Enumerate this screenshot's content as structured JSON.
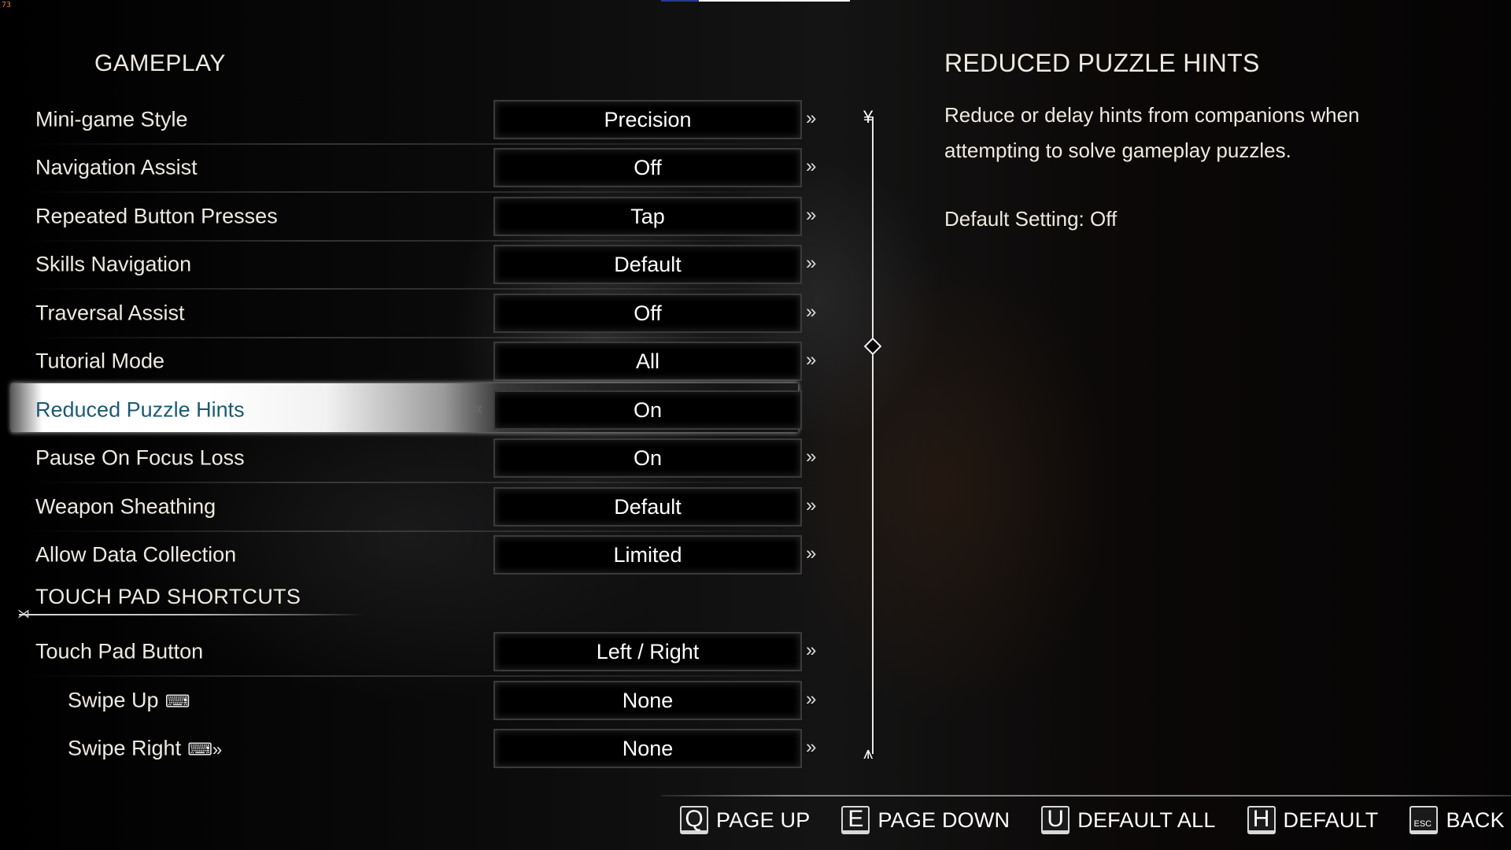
{
  "overlay": {
    "fps": "73",
    "top_progress": 0.2
  },
  "section": {
    "title": "GAMEPLAY"
  },
  "settings": [
    {
      "label": "Mini-game Style",
      "value": "Precision"
    },
    {
      "label": "Navigation Assist",
      "value": "Off"
    },
    {
      "label": "Repeated Button Presses",
      "value": "Tap"
    },
    {
      "label": "Skills Navigation",
      "value": "Default"
    },
    {
      "label": "Traversal Assist",
      "value": "Off"
    },
    {
      "label": "Tutorial Mode",
      "value": "All"
    },
    {
      "label": "Reduced Puzzle Hints",
      "value": "On",
      "selected": true
    },
    {
      "label": "Pause On Focus Loss",
      "value": "On"
    },
    {
      "label": "Weapon Sheathing",
      "value": "Default"
    },
    {
      "label": "Allow Data Collection",
      "value": "Limited"
    }
  ],
  "touchpad": {
    "title": "TOUCH PAD SHORTCUTS",
    "items": [
      {
        "label": "Touch Pad Button",
        "value": "Left / Right"
      },
      {
        "label": "Swipe Up",
        "value": "None",
        "icon": "touchpad-swipe-up-icon"
      },
      {
        "label": "Swipe Right",
        "value": "None",
        "icon": "touchpad-swipe-right-icon"
      }
    ]
  },
  "icons": {
    "next": "»",
    "prev": "«",
    "swipe_up": "⌨",
    "swipe_right": "⌨»"
  },
  "scrollbar": {
    "position": 0.36
  },
  "detail": {
    "title": "REDUCED PUZZLE HINTS",
    "description": "Reduce or delay hints from companions when attempting to solve gameplay puzzles.",
    "default_setting": "Default Setting: Off"
  },
  "footer": [
    {
      "key": "Q",
      "label": "PAGE UP"
    },
    {
      "key": "E",
      "label": "PAGE DOWN"
    },
    {
      "key": "U",
      "label": "DEFAULT ALL"
    },
    {
      "key": "H",
      "label": "DEFAULT"
    },
    {
      "key": "ESC",
      "label": "BACK"
    }
  ]
}
